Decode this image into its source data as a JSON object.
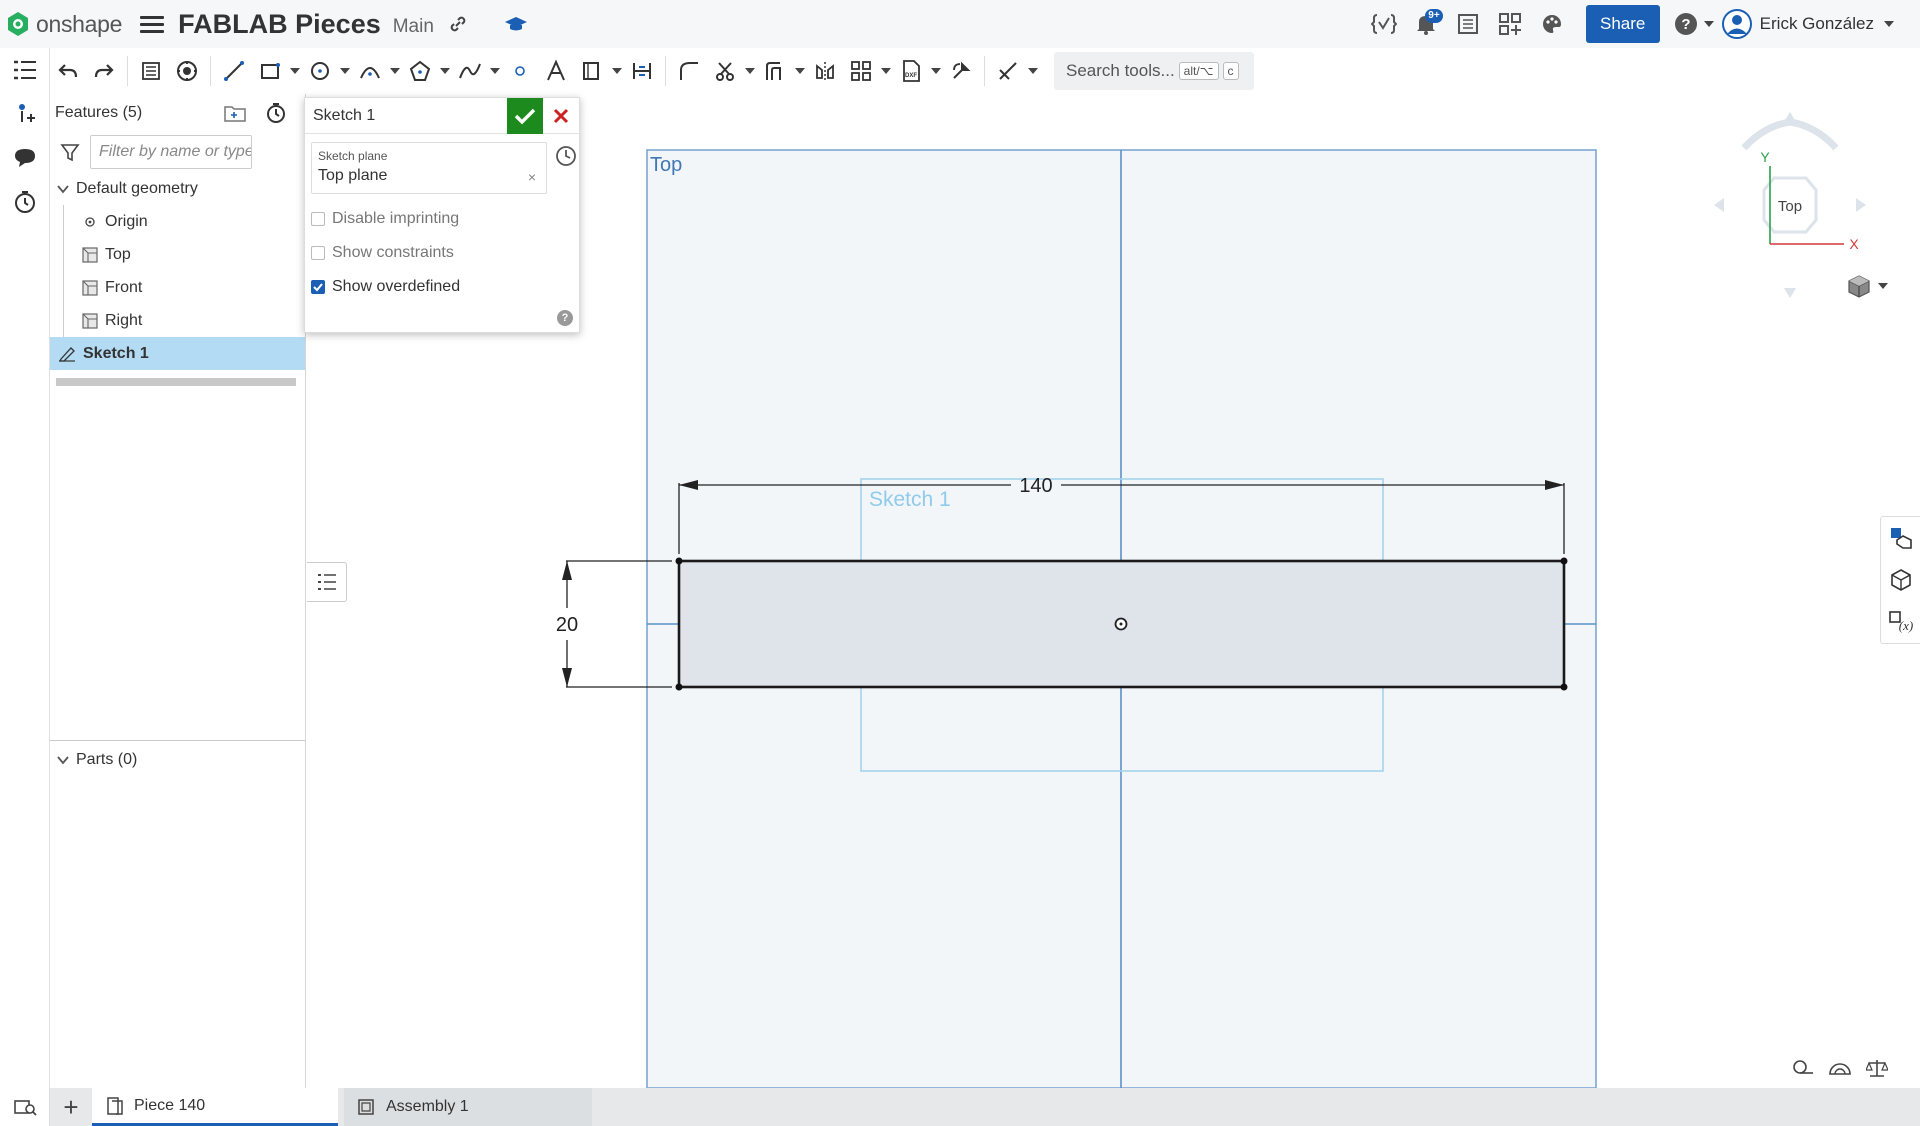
{
  "header": {
    "logo_text": "onshape",
    "document_title": "FABLAB Pieces",
    "branch": "Main",
    "notification_count": "9+",
    "share_label": "Share",
    "user_name": "Erick González",
    "icons": [
      "hamburger-icon",
      "link-icon",
      "graduation-cap-icon",
      "variable-icon",
      "bell-icon",
      "list-icon",
      "apps-icon",
      "palette-icon",
      "help-icon",
      "user-avatar-icon"
    ]
  },
  "toolbar": {
    "search_placeholder": "Search tools...",
    "search_shortcut_1": "alt/⌥",
    "search_shortcut_2": "c",
    "tools": [
      "undo",
      "redo",
      "use-edges",
      "sketch-settings",
      "line",
      "rectangle",
      "circle",
      "arc",
      "polygon",
      "spline",
      "point",
      "text",
      "construction",
      "dimension",
      "fillet",
      "trim",
      "offset",
      "mirror",
      "pattern",
      "dxf-import",
      "transform",
      "snap-mode"
    ]
  },
  "features": {
    "title": "Features (5)",
    "filter_placeholder": "Filter by name or type",
    "default_geometry_label": "Default geometry",
    "items": [
      {
        "label": "Origin",
        "icon": "origin-icon"
      },
      {
        "label": "Top",
        "icon": "plane-icon"
      },
      {
        "label": "Front",
        "icon": "plane-icon"
      },
      {
        "label": "Right",
        "icon": "plane-icon"
      }
    ],
    "sketch_label": "Sketch 1",
    "parts_label": "Parts (0)"
  },
  "sketch_dialog": {
    "title": "Sketch 1",
    "plane_label": "Sketch plane",
    "plane_value": "Top plane",
    "clear_symbol": "×",
    "options": [
      {
        "label": "Disable imprinting",
        "checked": false
      },
      {
        "label": "Show constraints",
        "checked": false
      },
      {
        "label": "Show overdefined",
        "checked": true
      }
    ],
    "help_symbol": "?"
  },
  "viewport": {
    "plane_name": "Top",
    "sketch_name": "Sketch 1",
    "width_dimension": "140",
    "height_dimension": "20",
    "plane_color": "#5b8fc9",
    "sketch_fill": "#dfe3ea"
  },
  "view_cube": {
    "face_label": "Top",
    "x_axis": "X",
    "y_axis": "Y"
  },
  "tabs": [
    {
      "label": "Piece 140",
      "active": true,
      "icon": "part-studio-icon"
    },
    {
      "label": "Assembly 1",
      "active": false,
      "icon": "assembly-icon"
    }
  ],
  "colors": {
    "accent": "#1a5fb4",
    "confirm": "#1d8a1d",
    "cancel": "#cc2222",
    "selection": "#b3dcf4"
  }
}
